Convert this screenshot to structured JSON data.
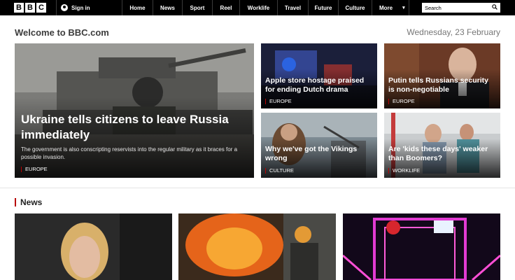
{
  "nav": {
    "logo_letters": [
      "B",
      "B",
      "C"
    ],
    "signin_label": "Sign in",
    "items": [
      "Home",
      "News",
      "Sport",
      "Reel",
      "Worklife",
      "Travel",
      "Future",
      "Culture",
      "More"
    ],
    "search_placeholder": "Search"
  },
  "header": {
    "welcome": "Welcome to BBC.com",
    "date": "Wednesday, 23 February"
  },
  "lead_story": {
    "title": "Ukraine tells citizens to leave Russia immediately",
    "summary": "The government is also conscripting reservists into the regular military as it braces for a possible invasion.",
    "tag": "EUROPE"
  },
  "stories": [
    {
      "title": "Apple store hostage praised for ending Dutch drama",
      "tag": "EUROPE"
    },
    {
      "title": "Putin tells Russians security is non-negotiable",
      "tag": "EUROPE"
    },
    {
      "title": "Why we've got the Vikings wrong",
      "tag": "CULTURE"
    },
    {
      "title": "Are 'kids these days' weaker than Boomers?",
      "tag": "WORKLIFE"
    }
  ],
  "news_section": {
    "title": "News"
  },
  "colors": {
    "accent": "#b80000",
    "nav_bg": "#000000"
  }
}
